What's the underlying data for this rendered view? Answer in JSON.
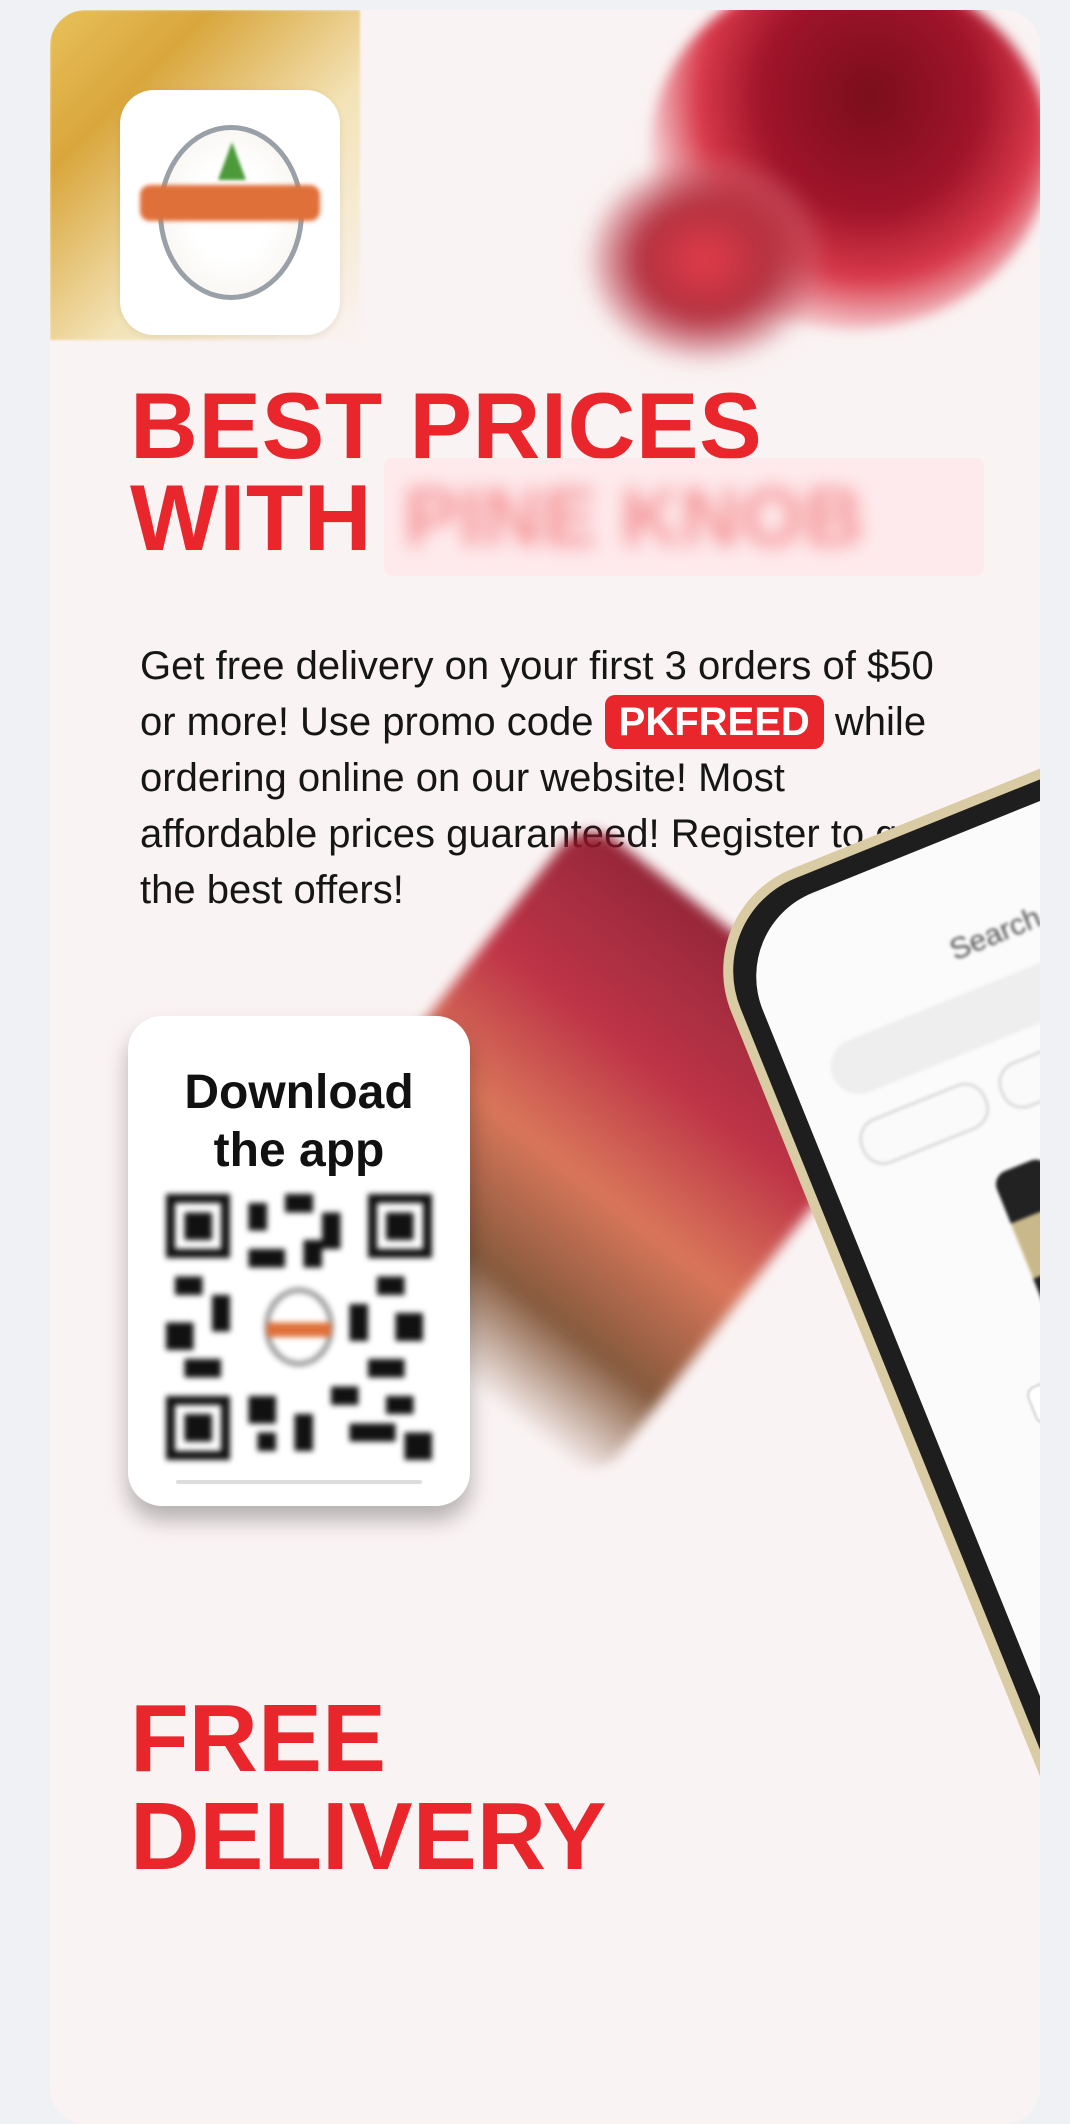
{
  "hero": {
    "headline_line1": "BEST PRICES",
    "headline_line2": "WITH",
    "brand_name_blurred": "PINE KNOB"
  },
  "description": {
    "text_before_code": "Get free delivery on your first 3 orders of $50 or more! Use promo code",
    "promo_code": "PKFREED",
    "text_after_code": "while ordering online on our website! Most affordable prices guaranteed! Register to get the best offers!"
  },
  "app_card": {
    "title_line1": "Download",
    "title_line2": "the app"
  },
  "phone_screen": {
    "title": "Search Product"
  },
  "footer": {
    "line1": "FREE",
    "line2": "DELIVERY"
  },
  "colors": {
    "accent_red": "#e8262b",
    "background": "#faf3f3",
    "phone_frame": "#d9cba4"
  },
  "icons": [
    "store-logo-icon",
    "qr-code-icon"
  ]
}
